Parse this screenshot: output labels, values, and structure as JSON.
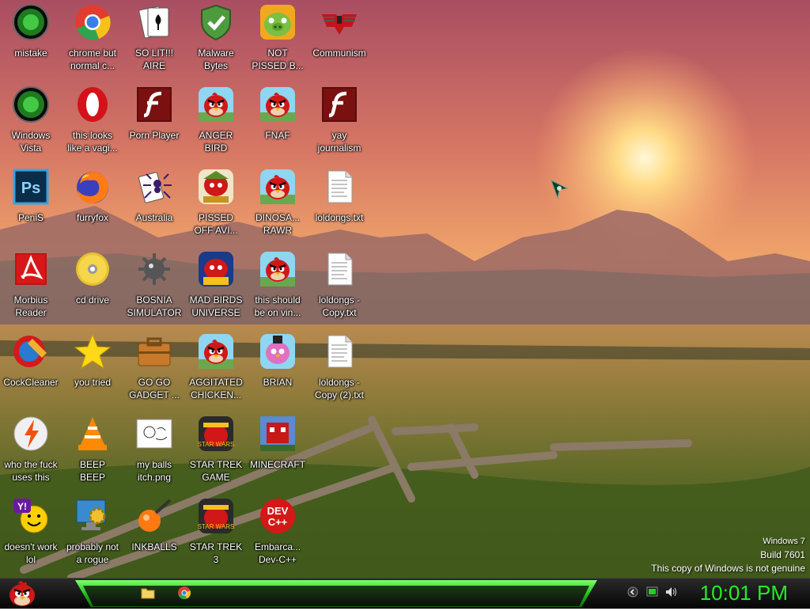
{
  "desktop": {
    "icons": [
      {
        "label": "mistake",
        "icon": "green-orb-icon"
      },
      {
        "label": "chrome but\nnormal c...",
        "icon": "chrome-icon"
      },
      {
        "label": "SO LIT!!!\nAIRE",
        "icon": "solitaire-icon"
      },
      {
        "label": "Malware\nBytes",
        "icon": "shield-check-icon"
      },
      {
        "label": "NOT\nPISSED B...",
        "icon": "green-pig-icon"
      },
      {
        "label": "Communism",
        "icon": "winged-emblem-icon"
      },
      {
        "label": "Windows\nVista",
        "icon": "green-orb-icon"
      },
      {
        "label": "this looks\nlike a vagi...",
        "icon": "opera-icon"
      },
      {
        "label": "Porn Player",
        "icon": "flash-icon"
      },
      {
        "label": "ANGER\nBIRD",
        "icon": "angry-bird-icon"
      },
      {
        "label": "FNAF",
        "icon": "angry-bird-icon"
      },
      {
        "label": "yay\njournalism",
        "icon": "flash-icon"
      },
      {
        "label": "PeniS",
        "icon": "photoshop-icon"
      },
      {
        "label": "furryfox",
        "icon": "firefox-icon"
      },
      {
        "label": "Australia",
        "icon": "spider-solitaire-icon"
      },
      {
        "label": "PISSED\nOFF AVI...",
        "icon": "angry-bird-seasons-icon"
      },
      {
        "label": "DINOSA...\nRAWR",
        "icon": "angry-bird-icon"
      },
      {
        "label": "loldongs.txt",
        "icon": "text-file-icon"
      },
      {
        "label": "Morbius\nReader",
        "icon": "acrobat-icon"
      },
      {
        "label": "cd drive",
        "icon": "cd-icon"
      },
      {
        "label": "BOSNIA\nSIMULATOR",
        "icon": "mine-icon"
      },
      {
        "label": "MAD BIRDS\nUNIVERSE",
        "icon": "angry-bird-space-icon"
      },
      {
        "label": "this should\nbe on vin...",
        "icon": "angry-bird-icon"
      },
      {
        "label": "loldongs -\nCopy.txt",
        "icon": "text-file-icon"
      },
      {
        "label": "CockCleaner",
        "icon": "ccleaner-icon"
      },
      {
        "label": "you tried",
        "icon": "star-icon"
      },
      {
        "label": "GO GO\nGADGET ...",
        "icon": "briefcase-icon"
      },
      {
        "label": "AGGITATED\nCHICKEN...",
        "icon": "angry-bird-icon"
      },
      {
        "label": "BRIAN",
        "icon": "angry-bird-stella-icon"
      },
      {
        "label": "loldongs -\nCopy (2).txt",
        "icon": "text-file-icon"
      },
      {
        "label": "who the fuck\nuses this",
        "icon": "winamp-icon"
      },
      {
        "label": "BEEP\nBEEP",
        "icon": "vlc-icon"
      },
      {
        "label": "my balls\nitch.png",
        "icon": "image-file-icon"
      },
      {
        "label": "STAR TREK\nGAME",
        "icon": "angry-bird-starwars-icon"
      },
      {
        "label": "MINECRAFT",
        "icon": "minecraft-bird-icon"
      },
      {
        "label": "doesn't work\nlol",
        "icon": "yahoo-messenger-icon"
      },
      {
        "label": "probably not\na rogue",
        "icon": "computer-gear-icon"
      },
      {
        "label": "INKBALLS",
        "icon": "inkball-icon"
      },
      {
        "label": "STAR TREK\n3",
        "icon": "angry-bird-starwars-icon"
      },
      {
        "label": "Embarca...\nDev-C++",
        "icon": "devcpp-icon"
      }
    ]
  },
  "watermark": {
    "line1": "Windows 7",
    "line2": "Build 7601",
    "line3": "This copy of Windows is not genuine"
  },
  "taskbar": {
    "start_icon": "angry-bird-icon",
    "pinned": [
      "folder-icon",
      "chrome-icon"
    ],
    "tray_icons": [
      "back-arrow-icon",
      "battery-icon",
      "speaker-icon"
    ],
    "clock": "10:01 PM"
  },
  "colors": {
    "clock": "#22ee22",
    "taskbar_accent": "#22c21a",
    "label_text": "#ffffff"
  }
}
